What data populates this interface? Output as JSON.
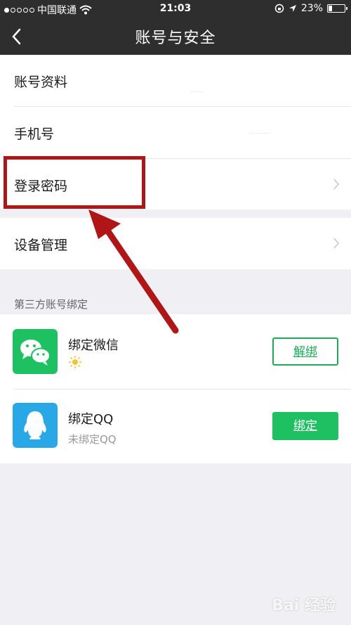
{
  "status_bar": {
    "carrier": "中国联通",
    "time": "21:03",
    "battery": "23%",
    "battery_level": 0.23
  },
  "nav": {
    "title": "账号与安全",
    "back_icon": "chevron-left-icon"
  },
  "account_rows": [
    {
      "label": "账号资料"
    },
    {
      "label": "手机号"
    },
    {
      "label": "登录密码"
    }
  ],
  "device_row": {
    "label": "设备管理"
  },
  "third_party": {
    "header": "第三方账号绑定",
    "items": [
      {
        "title": "绑定微信",
        "subtitle": "",
        "button": "解绑",
        "icon": "wechat-icon"
      },
      {
        "title": "绑定QQ",
        "subtitle": "未绑定QQ",
        "button": "绑定",
        "icon": "qq-icon"
      }
    ]
  },
  "colors": {
    "nav_bg": "#2e2e2e",
    "accent_green": "#1ec161",
    "highlight_red": "#b11616",
    "qq_blue": "#29a8e8"
  },
  "watermark": "Bai 经验"
}
